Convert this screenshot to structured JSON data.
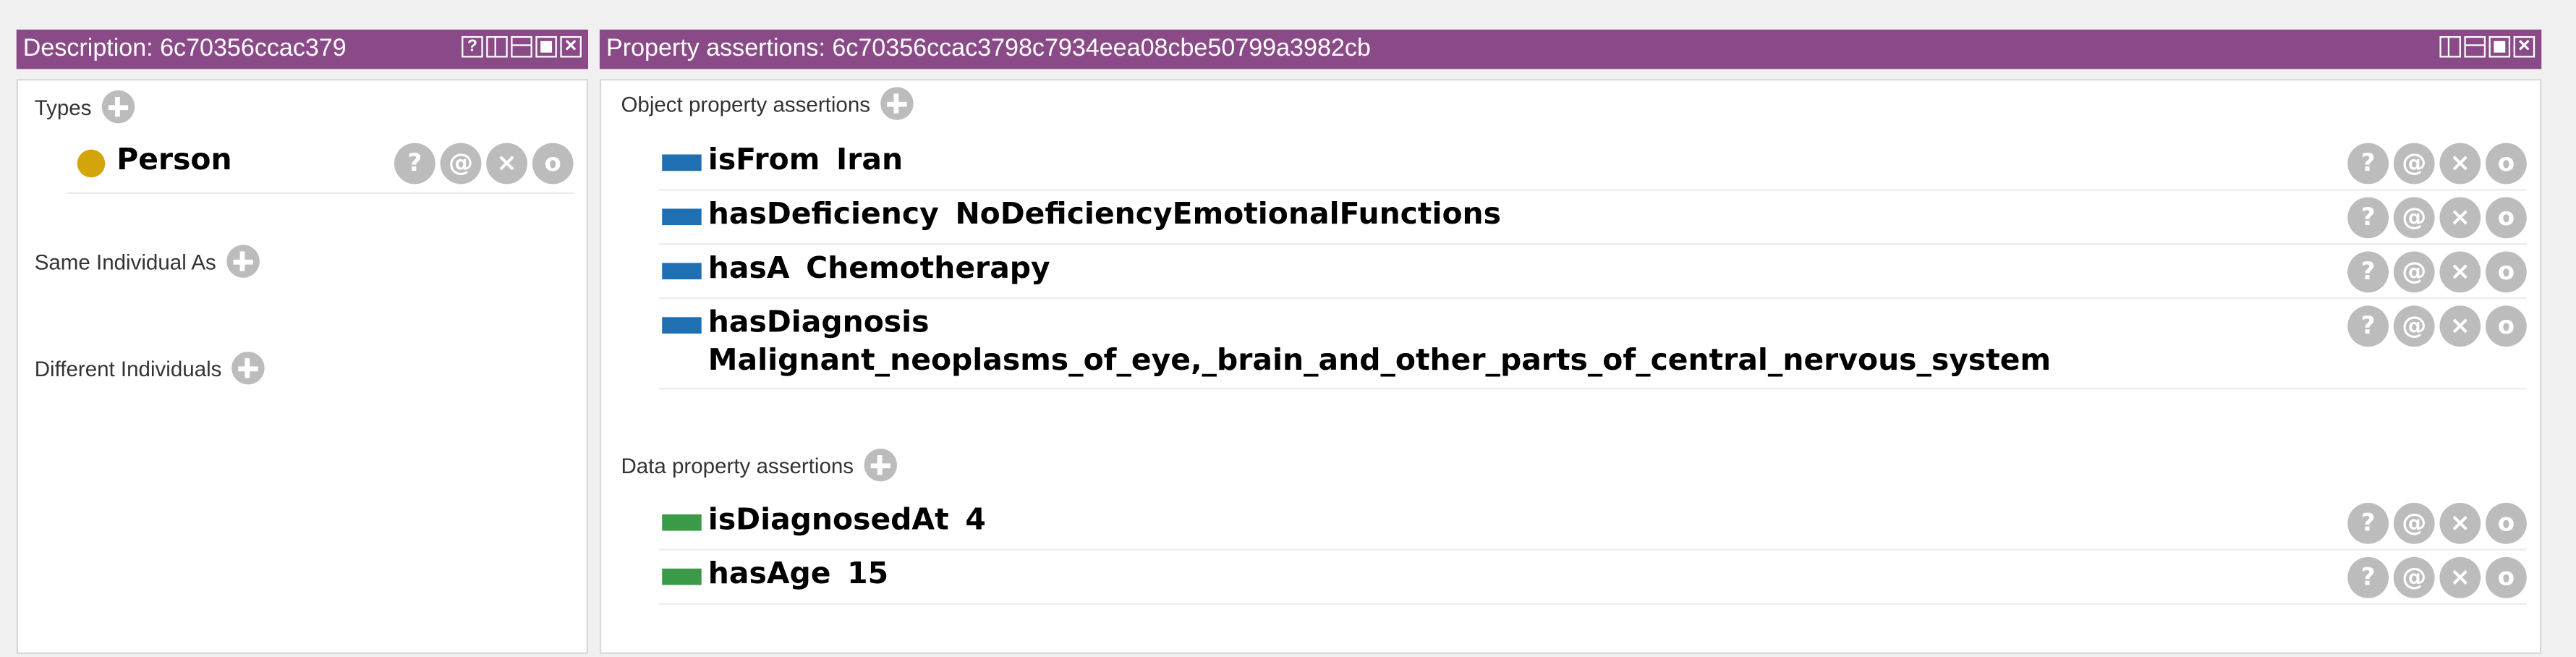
{
  "left_panel": {
    "title": "Description: 6c70356ccac379",
    "types": {
      "label": "Types",
      "items": [
        {
          "name": "Person"
        }
      ]
    },
    "same_individual": {
      "label": "Same Individual As"
    },
    "different_individuals": {
      "label": "Different Individuals"
    },
    "window_buttons": [
      "help-icon",
      "split-vertical-icon",
      "split-horizontal-icon",
      "maximize-icon",
      "close-icon"
    ]
  },
  "right_panel": {
    "title": "Property assertions: 6c70356ccac3798c7934eea08cbe50799a3982cb",
    "object_section": {
      "label": "Object property assertions"
    },
    "object_assertions": [
      {
        "property": "isFrom",
        "value": "Iran"
      },
      {
        "property": "hasDeficiency",
        "value": "NoDeficiencyEmotionalFunctions"
      },
      {
        "property": "hasA",
        "value": "Chemotherapy"
      },
      {
        "property": "hasDiagnosis",
        "value": "Malignant_neoplasms_of_eye,_brain_and_other_parts_of_central_nervous_system"
      }
    ],
    "data_section": {
      "label": "Data property assertions"
    },
    "data_assertions": [
      {
        "property": "isDiagnosedAt",
        "value": "4"
      },
      {
        "property": "hasAge",
        "value": "15"
      }
    ],
    "window_buttons": [
      "split-vertical-icon",
      "split-horizontal-icon",
      "maximize-icon",
      "close-icon"
    ]
  },
  "row_actions": {
    "help": "?",
    "annotate": "@",
    "delete": "×",
    "edit": "o"
  },
  "colors": {
    "titlebar": "#8a4a87",
    "object_property": "#1f6fb3",
    "data_property": "#3a9a47",
    "class_individual": "#d4a50a",
    "action_button": "#bcbcbc"
  }
}
